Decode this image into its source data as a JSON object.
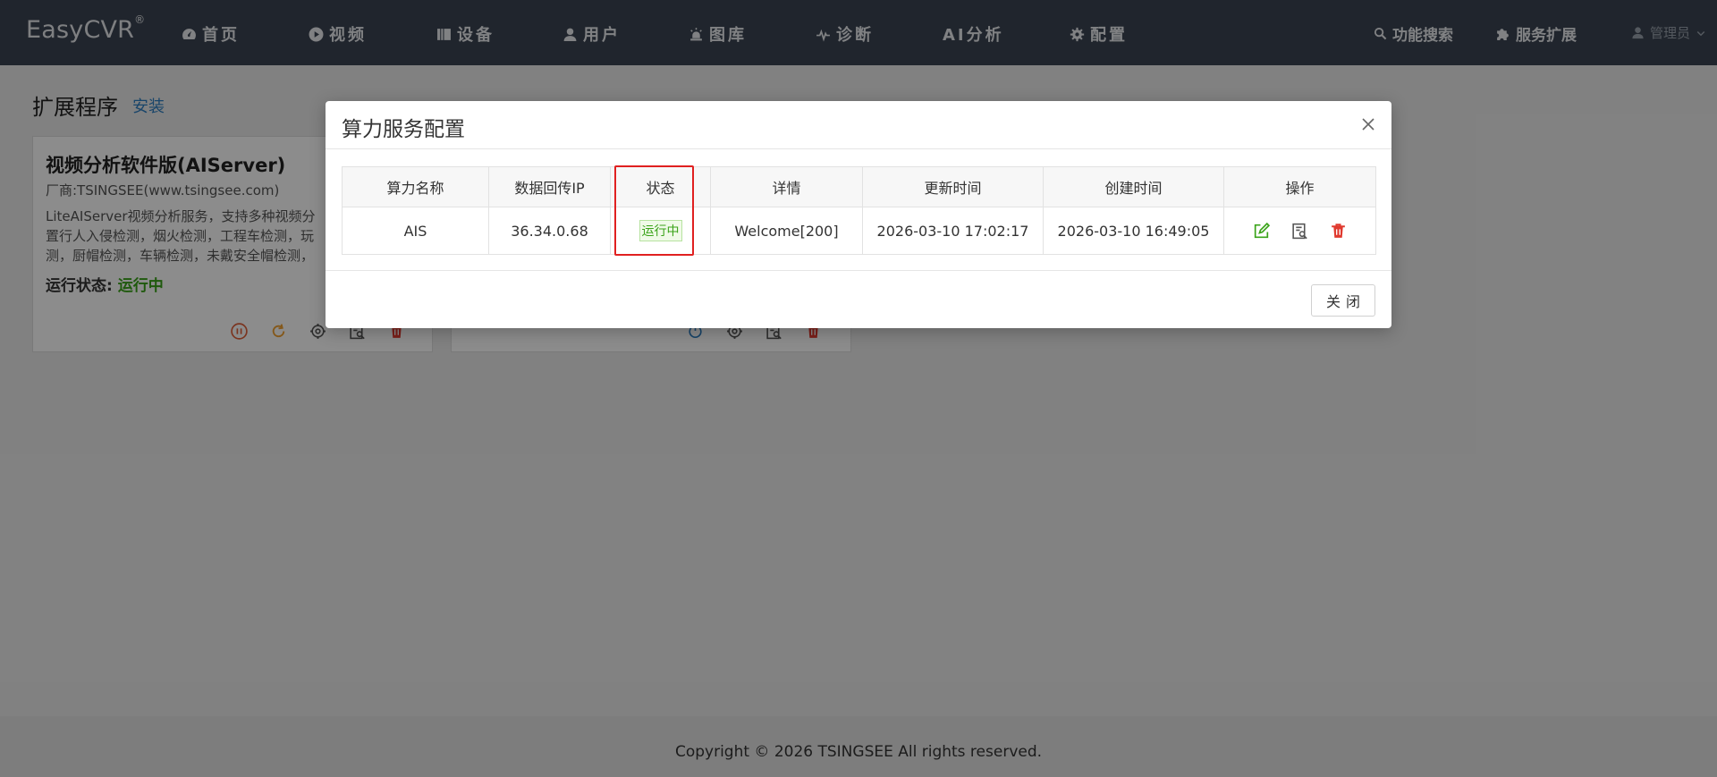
{
  "app": {
    "logo": "EasyCVR",
    "logo_mark": "®"
  },
  "nav": {
    "items": [
      {
        "label": "首页",
        "icon": "dashboard-icon"
      },
      {
        "label": "视频",
        "icon": "play-icon"
      },
      {
        "label": "设备",
        "icon": "device-icon"
      },
      {
        "label": "用户",
        "icon": "user-icon"
      },
      {
        "label": "图库",
        "icon": "gallery-icon"
      },
      {
        "label": "诊断",
        "icon": "pulse-icon"
      },
      {
        "label": "AI分析",
        "icon": ""
      },
      {
        "label": "配置",
        "icon": "gear-icon"
      }
    ],
    "search_label": "功能搜索",
    "extension_label": "服务扩展",
    "user_label": "管理员"
  },
  "page": {
    "title": "扩展程序",
    "install_label": "安装"
  },
  "cards": [
    {
      "title": "视频分析软件版(AIServer)",
      "vendor": "厂商:TSINGSEE(www.tsingsee.com)",
      "desc_lines": [
        "LiteAIServer视频分析服务，支持多种视频分",
        "置行人入侵检测，烟火检测，工程车检测，玩",
        "测，厨帽检测，车辆检测，未戴安全帽检测，"
      ],
      "status_label": "运行状态:",
      "status_value": "运行中"
    }
  ],
  "footer": {
    "copyright": "Copyright © 2026 TSINGSEE All rights reserved."
  },
  "modal": {
    "title": "算力服务配置",
    "columns": [
      "算力名称",
      "数据回传IP",
      "状态",
      "详情",
      "更新时间",
      "创建时间",
      "操作"
    ],
    "rows": [
      {
        "name": "AIS",
        "ip": "36.34.0.68",
        "status": "运行中",
        "detail": "Welcome[200]",
        "updated": "2026-03-10 17:02:17",
        "created": "2026-03-10 16:49:05"
      }
    ],
    "close_label": "关闭"
  },
  "colors": {
    "nav_bg": "#3b4452",
    "status_green": "#3aa319",
    "highlight_red": "#e02020",
    "delete_red": "#e03a2f",
    "link_blue": "#2f7fc1"
  }
}
